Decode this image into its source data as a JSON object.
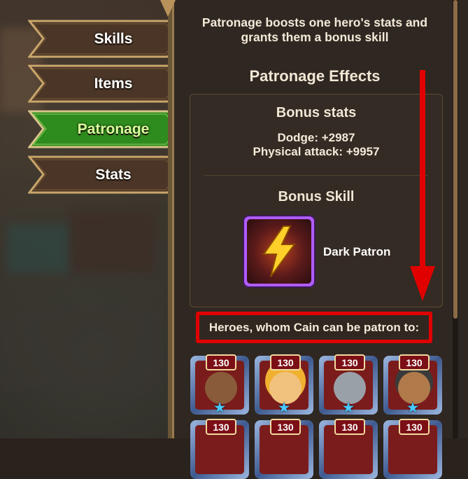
{
  "tabs": [
    {
      "label": "Skills",
      "active": false
    },
    {
      "label": "Items",
      "active": false
    },
    {
      "label": "Patronage",
      "active": true
    },
    {
      "label": "Stats",
      "active": false
    }
  ],
  "panel": {
    "intro": "Patronage boosts one hero's stats and grants them a bonus skill",
    "effects_title": "Patronage Effects",
    "bonus_stats_title": "Bonus stats",
    "stats": [
      "Dodge: +2987",
      "Physical attack: +9957"
    ],
    "bonus_skill_title": "Bonus Skill",
    "skill_name": "Dark Patron",
    "skill_icon": "lightning-bolt-icon",
    "heroes_label": "Heroes, whom Cain can be patron to:"
  },
  "heroes": [
    {
      "level": "130"
    },
    {
      "level": "130"
    },
    {
      "level": "130"
    },
    {
      "level": "130"
    },
    {
      "level": "130"
    },
    {
      "level": "130"
    },
    {
      "level": "130"
    },
    {
      "level": "130"
    }
  ],
  "colors": {
    "active_tab": "#2e8b1e",
    "inactive_tab": "#4a3526",
    "highlight": "#e00000",
    "skill_frame": "#b05cff"
  }
}
